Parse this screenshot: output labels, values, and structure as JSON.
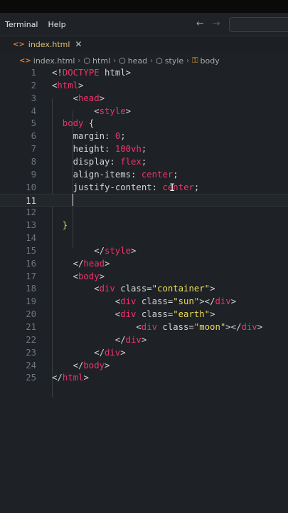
{
  "menu": [
    "Terminal",
    "Help"
  ],
  "tab": {
    "filename": "index.html",
    "close": "✕"
  },
  "breadcrumb": [
    "index.html",
    "html",
    "head",
    "style",
    "body"
  ],
  "lines": [
    {
      "n": "1",
      "indent": 0,
      "tokens": [
        [
          "b",
          "<!"
        ],
        [
          "t",
          "DOCTYPE"
        ],
        [
          "b",
          " html>"
        ]
      ]
    },
    {
      "n": "2",
      "indent": 0,
      "tokens": [
        [
          "b",
          "<"
        ],
        [
          "t",
          "html"
        ],
        [
          "b",
          ">"
        ]
      ]
    },
    {
      "n": "3",
      "indent": 4,
      "tokens": [
        [
          "b",
          "<"
        ],
        [
          "t",
          "head"
        ],
        [
          "b",
          ">"
        ]
      ]
    },
    {
      "n": "4",
      "indent": 8,
      "tokens": [
        [
          "b",
          "<"
        ],
        [
          "t",
          "style"
        ],
        [
          "b",
          ">"
        ]
      ]
    },
    {
      "n": "5",
      "indent": 2,
      "tokens": [
        [
          "t",
          "body"
        ],
        [
          "b",
          " "
        ],
        [
          "s",
          "{"
        ]
      ]
    },
    {
      "n": "6",
      "indent": 4,
      "tokens": [
        [
          "b",
          "margin: "
        ],
        [
          "v",
          "0"
        ],
        [
          "b",
          ";"
        ]
      ]
    },
    {
      "n": "7",
      "indent": 4,
      "tokens": [
        [
          "b",
          "height: "
        ],
        [
          "v",
          "100vh"
        ],
        [
          "b",
          ";"
        ]
      ]
    },
    {
      "n": "8",
      "indent": 4,
      "tokens": [
        [
          "b",
          "display: "
        ],
        [
          "v",
          "flex"
        ],
        [
          "b",
          ";"
        ]
      ]
    },
    {
      "n": "9",
      "indent": 4,
      "tokens": [
        [
          "b",
          "align-items: "
        ],
        [
          "v",
          "center"
        ],
        [
          "b",
          ";"
        ]
      ]
    },
    {
      "n": "10",
      "indent": 4,
      "tokens": [
        [
          "b",
          "justify-content: "
        ],
        [
          "v",
          "center"
        ],
        [
          "b",
          ";"
        ]
      ]
    },
    {
      "n": "11",
      "indent": 4,
      "tokens": []
    },
    {
      "n": "12",
      "indent": 0,
      "tokens": []
    },
    {
      "n": "13",
      "indent": 2,
      "tokens": [
        [
          "s",
          "}"
        ]
      ]
    },
    {
      "n": "14",
      "indent": 0,
      "tokens": []
    },
    {
      "n": "15",
      "indent": 8,
      "tokens": [
        [
          "b",
          "</"
        ],
        [
          "t",
          "style"
        ],
        [
          "b",
          ">"
        ]
      ]
    },
    {
      "n": "16",
      "indent": 4,
      "tokens": [
        [
          "b",
          "</"
        ],
        [
          "t",
          "head"
        ],
        [
          "b",
          ">"
        ]
      ]
    },
    {
      "n": "17",
      "indent": 4,
      "tokens": [
        [
          "b",
          "<"
        ],
        [
          "t",
          "body"
        ],
        [
          "b",
          ">"
        ]
      ]
    },
    {
      "n": "18",
      "indent": 8,
      "tokens": [
        [
          "b",
          "<"
        ],
        [
          "t",
          "div"
        ],
        [
          "b",
          " class="
        ],
        [
          "s",
          "\"container\""
        ],
        [
          "b",
          ">"
        ]
      ]
    },
    {
      "n": "19",
      "indent": 12,
      "tokens": [
        [
          "b",
          "<"
        ],
        [
          "t",
          "div"
        ],
        [
          "b",
          " class="
        ],
        [
          "s",
          "\"sun\""
        ],
        [
          "b",
          "></"
        ],
        [
          "t",
          "div"
        ],
        [
          "b",
          ">"
        ]
      ]
    },
    {
      "n": "20",
      "indent": 12,
      "tokens": [
        [
          "b",
          "<"
        ],
        [
          "t",
          "div"
        ],
        [
          "b",
          " class="
        ],
        [
          "s",
          "\"earth\""
        ],
        [
          "b",
          ">"
        ]
      ]
    },
    {
      "n": "21",
      "indent": 16,
      "tokens": [
        [
          "b",
          "<"
        ],
        [
          "t",
          "div"
        ],
        [
          "b",
          " class="
        ],
        [
          "s",
          "\"moon\""
        ],
        [
          "b",
          "></"
        ],
        [
          "t",
          "div"
        ],
        [
          "b",
          ">"
        ]
      ]
    },
    {
      "n": "22",
      "indent": 12,
      "tokens": [
        [
          "b",
          "</"
        ],
        [
          "t",
          "div"
        ],
        [
          "b",
          ">"
        ]
      ]
    },
    {
      "n": "23",
      "indent": 8,
      "tokens": [
        [
          "b",
          "</"
        ],
        [
          "t",
          "div"
        ],
        [
          "b",
          ">"
        ]
      ]
    },
    {
      "n": "24",
      "indent": 4,
      "tokens": [
        [
          "b",
          "</"
        ],
        [
          "t",
          "body"
        ],
        [
          "b",
          ">"
        ]
      ]
    },
    {
      "n": "25",
      "indent": 0,
      "tokens": [
        [
          "b",
          "</"
        ],
        [
          "t",
          "html"
        ],
        [
          "b",
          ">"
        ]
      ]
    }
  ],
  "active_line": "11",
  "colors": {
    "background": "#1e2125",
    "tag": "#f0336b",
    "string": "#ecdc5a",
    "text": "#d4d4d4",
    "line_number": "#6e7681"
  }
}
